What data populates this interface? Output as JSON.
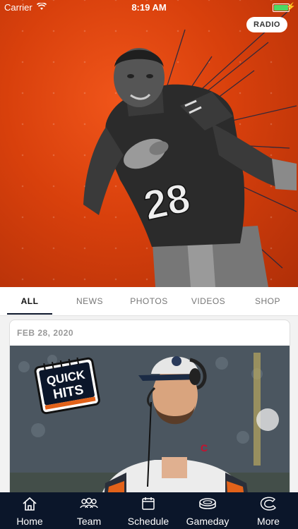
{
  "status": {
    "carrier": "Carrier",
    "time": "8:19 AM"
  },
  "hero": {
    "radio_label": "RADIO",
    "jersey_number": "28"
  },
  "tabs": [
    {
      "label": "ALL",
      "active": true
    },
    {
      "label": "NEWS",
      "active": false
    },
    {
      "label": "PHOTOS",
      "active": false
    },
    {
      "label": "VIDEOS",
      "active": false
    },
    {
      "label": "SHOP",
      "active": false
    }
  ],
  "card": {
    "date": "FEB 28, 2020",
    "badge_line1": "QUICK",
    "badge_line2": "HITS",
    "cap_logo": "C"
  },
  "nav": [
    {
      "label": "Home",
      "icon": "home-icon"
    },
    {
      "label": "Team",
      "icon": "team-icon"
    },
    {
      "label": "Schedule",
      "icon": "calendar-icon"
    },
    {
      "label": "Gameday",
      "icon": "stadium-icon"
    },
    {
      "label": "More",
      "icon": "bears-logo-icon"
    }
  ],
  "colors": {
    "orange": "#d8400c",
    "navy": "#0b162a",
    "battery": "#4cd964"
  }
}
